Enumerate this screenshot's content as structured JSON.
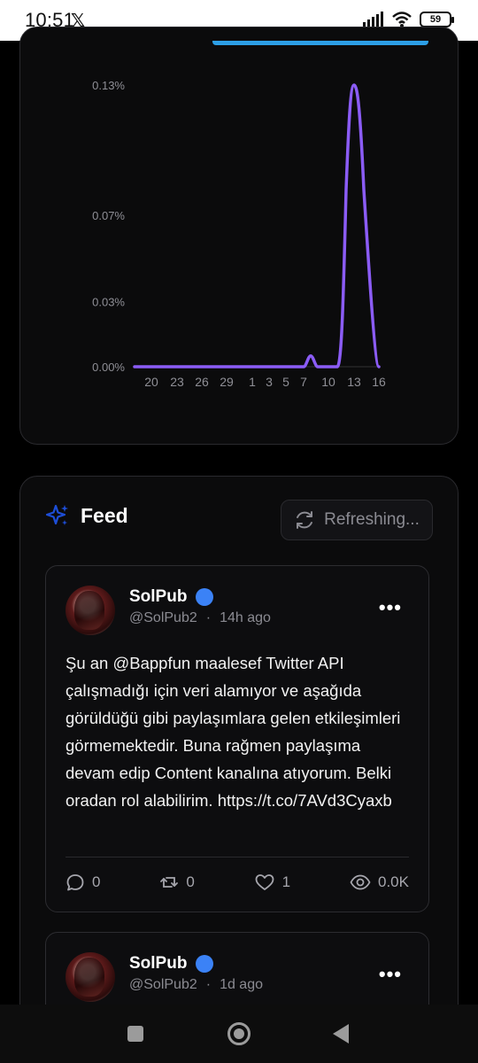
{
  "status_bar": {
    "time": "10:51",
    "x_logo": "𝕏",
    "battery": "59"
  },
  "chart_data": {
    "type": "area",
    "x_ticks": [
      "20",
      "23",
      "26",
      "29",
      "1",
      "3",
      "5",
      "7",
      "10",
      "13",
      "16"
    ],
    "y_ticks": [
      "0.13%",
      "0.07%",
      "0.03%",
      "0.00%"
    ],
    "series": [
      {
        "values": [
          0,
          0,
          0,
          0,
          0,
          0,
          0,
          0.005,
          0,
          0.13,
          0
        ]
      }
    ],
    "ylim": [
      0,
      0.13
    ],
    "line_color": "#8b5cf6"
  },
  "feed": {
    "title": "Feed",
    "refresh_label": "Refreshing...",
    "posts": [
      {
        "name": "SolPub",
        "handle": "@SolPub2",
        "time": "14h ago",
        "text": "Şu an @Bappfun maalesef Twitter API çalışmadığı için veri alamıyor ve aşağıda görüldüğü gibi paylaşımlara gelen etkileşimleri görmemektedir. Buna rağmen paylaşıma devam edip Content kanalına atıyorum. Belki oradan rol alabilirim. https://t.co/7AVd3Cyaxb",
        "replies": "0",
        "retweets": "0",
        "likes": "1",
        "views": "0.0K"
      },
      {
        "name": "SolPub",
        "handle": "@SolPub2",
        "time": "1d ago"
      }
    ]
  },
  "colors": {
    "accent": "#2d9fe6",
    "verified": "#3b82f6",
    "sparkle": "#1d4ed8"
  }
}
